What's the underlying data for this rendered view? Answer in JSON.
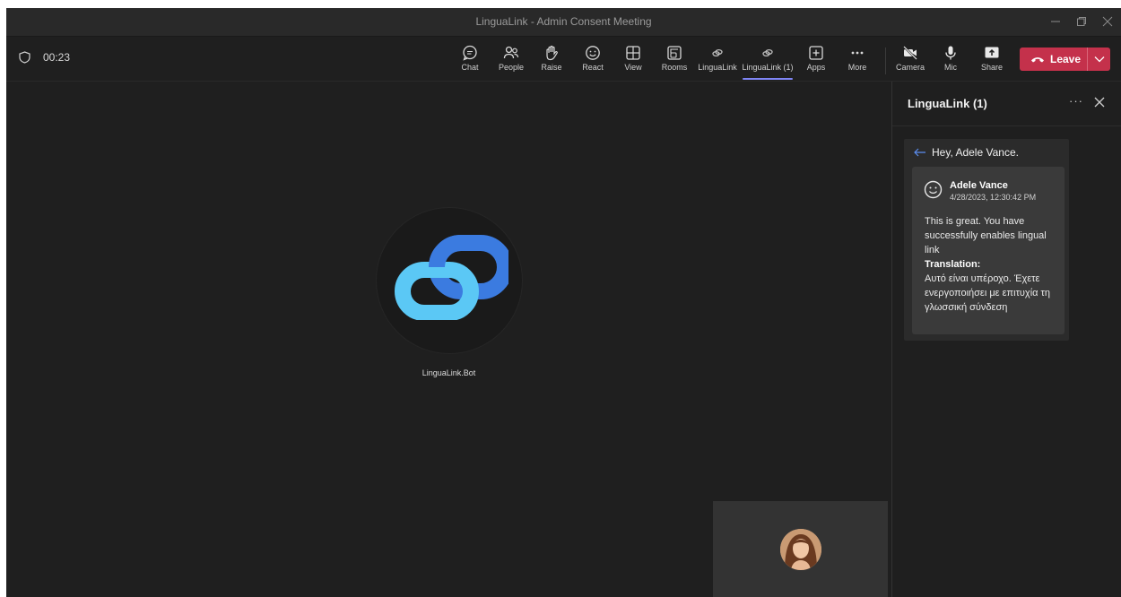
{
  "window": {
    "title": "LinguaLink - Admin Consent Meeting"
  },
  "toolbar": {
    "timer": "00:23",
    "buttons": [
      {
        "label": "Chat",
        "icon": "chat-icon"
      },
      {
        "label": "People",
        "icon": "people-icon"
      },
      {
        "label": "Raise",
        "icon": "raise-hand-icon"
      },
      {
        "label": "React",
        "icon": "react-smiley-icon"
      },
      {
        "label": "View",
        "icon": "view-grid-icon"
      },
      {
        "label": "Rooms",
        "icon": "rooms-icon"
      },
      {
        "label": "LinguaLink",
        "icon": "lingualink-app-icon"
      },
      {
        "label": "LinguaLink (1)",
        "icon": "lingualink-app-icon",
        "active": true
      },
      {
        "label": "Apps",
        "icon": "apps-plus-icon"
      },
      {
        "label": "More",
        "icon": "more-dots-icon"
      },
      {
        "label": "Camera",
        "icon": "camera-off-icon"
      },
      {
        "label": "Mic",
        "icon": "mic-icon"
      },
      {
        "label": "Share",
        "icon": "share-icon"
      }
    ],
    "leave_label": "Leave"
  },
  "stage": {
    "participant_name": "LinguaLink.Bot"
  },
  "panel": {
    "title": "LinguaLink (1)",
    "greeting": "Hey, Adele Vance.",
    "message": {
      "sender": "Adele Vance",
      "timestamp": "4/28/2023, 12:30:42 PM",
      "text": "This is great. You have successfully enables lingual link",
      "translation_label": "Translation:",
      "translation": "Αυτό είναι υπέροχο. Έχετε ενεργοποιήσει με επιτυχία τη γλωσσική σύνδεση"
    }
  },
  "colors": {
    "leave": "#c4314b",
    "active_tab": "#7f85f5",
    "logo_blue": "#3b7be0",
    "logo_light": "#5bc8f5"
  }
}
